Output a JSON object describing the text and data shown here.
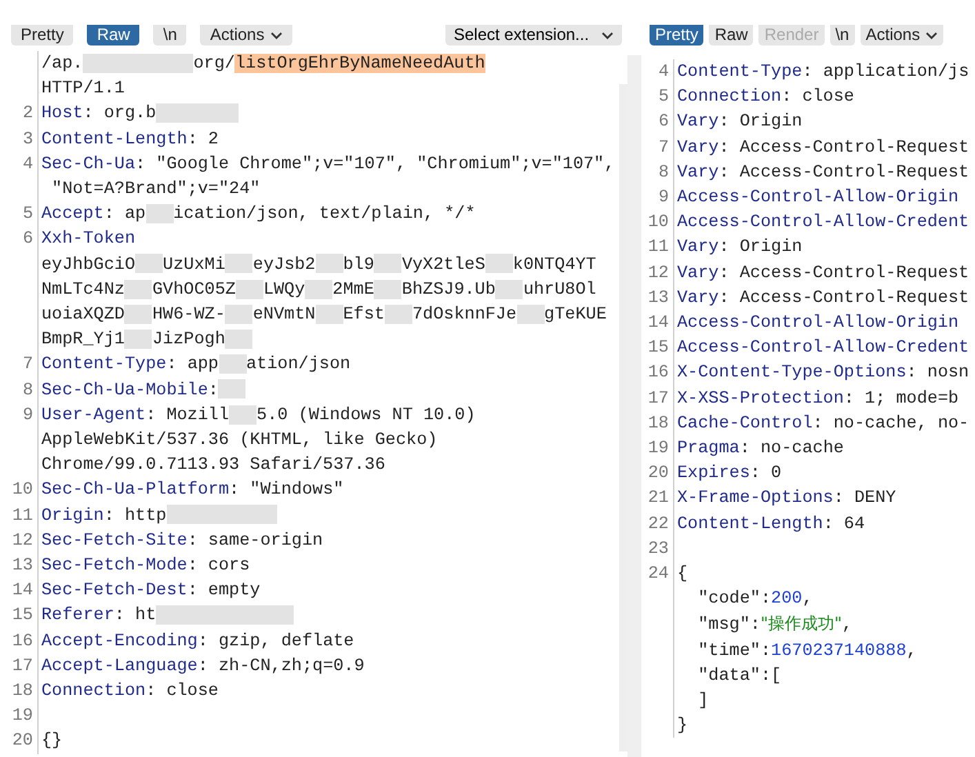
{
  "request": {
    "toolbar": [
      {
        "label": "Pretty",
        "selected": false
      },
      {
        "label": "Raw",
        "selected": true
      },
      {
        "label": "\\n",
        "selected": false
      },
      {
        "label": "Actions",
        "selected": false,
        "kind": "menu"
      }
    ],
    "extension_select": {
      "label": "Select extension..."
    },
    "lines": [
      {
        "parts": [
          {
            "kind": "text",
            "text": "/ap."
          },
          {
            "kind": "redacted"
          },
          {
            "kind": "redacted"
          },
          {
            "kind": "redacted"
          },
          {
            "kind": "redacted"
          },
          {
            "kind": "text",
            "text": "org/"
          },
          {
            "kind": "highlight",
            "text": "listOrgEhrByNameNeedAuth"
          }
        ]
      },
      {
        "parts": [
          {
            "kind": "text",
            "text": "HTTP/1.1"
          }
        ]
      },
      {
        "num": "2",
        "parts": [
          {
            "kind": "name",
            "text": "Host"
          },
          {
            "kind": "text",
            "text": ": org.b"
          },
          {
            "kind": "redacted"
          },
          {
            "kind": "redacted"
          },
          {
            "kind": "redacted"
          }
        ]
      },
      {
        "num": "3",
        "parts": [
          {
            "kind": "name",
            "text": "Content-Length"
          },
          {
            "kind": "text",
            "text": ": 2"
          }
        ]
      },
      {
        "num": "4",
        "parts": [
          {
            "kind": "name",
            "text": "Sec-Ch-Ua"
          },
          {
            "kind": "text",
            "text": ": \"Google Chrome\";v=\"107\", \"Chromium\";v=\"107\","
          }
        ]
      },
      {
        "parts": [
          {
            "kind": "text",
            "text": " \"Not=A?Brand\";v=\"24\""
          }
        ]
      },
      {
        "num": "5",
        "parts": [
          {
            "kind": "name",
            "text": "Accept"
          },
          {
            "kind": "text",
            "text": ": ap"
          },
          {
            "kind": "redacted"
          },
          {
            "kind": "text",
            "text": "ication/json, text/plain, */*"
          }
        ]
      },
      {
        "num": "6",
        "parts": [
          {
            "kind": "name",
            "text": "Xxh-Token"
          }
        ]
      },
      {
        "parts": [
          {
            "kind": "text",
            "text": "eyJhbGciO"
          },
          {
            "kind": "redacted"
          },
          {
            "kind": "text",
            "text": "UzUxMi"
          },
          {
            "kind": "redacted"
          },
          {
            "kind": "text",
            "text": "eyJsb2"
          },
          {
            "kind": "redacted"
          },
          {
            "kind": "text",
            "text": "bl9"
          },
          {
            "kind": "redacted"
          },
          {
            "kind": "text",
            "text": "VyX2tleS"
          },
          {
            "kind": "redacted"
          },
          {
            "kind": "text",
            "text": "k0NTQ4YT"
          }
        ]
      },
      {
        "parts": [
          {
            "kind": "text",
            "text": "NmLTc4Nz"
          },
          {
            "kind": "redacted"
          },
          {
            "kind": "text",
            "text": "GVhOC05Z"
          },
          {
            "kind": "redacted"
          },
          {
            "kind": "text",
            "text": "LWQy"
          },
          {
            "kind": "redacted"
          },
          {
            "kind": "text",
            "text": "2MmE"
          },
          {
            "kind": "redacted"
          },
          {
            "kind": "text",
            "text": "BhZSJ9.Ub"
          },
          {
            "kind": "redacted"
          },
          {
            "kind": "text",
            "text": "uhrU8Ol"
          }
        ]
      },
      {
        "parts": [
          {
            "kind": "text",
            "text": "uoiaXQZD"
          },
          {
            "kind": "redacted"
          },
          {
            "kind": "text",
            "text": "HW6-WZ-"
          },
          {
            "kind": "redacted"
          },
          {
            "kind": "text",
            "text": "eNVmtN"
          },
          {
            "kind": "redacted"
          },
          {
            "kind": "text",
            "text": "Efst"
          },
          {
            "kind": "redacted"
          },
          {
            "kind": "text",
            "text": "7dOsknnFJe"
          },
          {
            "kind": "redacted"
          },
          {
            "kind": "text",
            "text": "gTeKUE"
          }
        ]
      },
      {
        "parts": [
          {
            "kind": "text",
            "text": "BmpR_Yj1"
          },
          {
            "kind": "redacted"
          },
          {
            "kind": "text",
            "text": "JizPogh"
          },
          {
            "kind": "redacted"
          }
        ]
      },
      {
        "num": "7",
        "parts": [
          {
            "kind": "name",
            "text": "Content-Type"
          },
          {
            "kind": "text",
            "text": ": app"
          },
          {
            "kind": "redacted"
          },
          {
            "kind": "text",
            "text": "ation/json"
          }
        ]
      },
      {
        "num": "8",
        "parts": [
          {
            "kind": "name",
            "text": "Sec-Ch-Ua-Mobile"
          },
          {
            "kind": "text",
            "text": ":"
          },
          {
            "kind": "redacted"
          }
        ]
      },
      {
        "num": "9",
        "parts": [
          {
            "kind": "name",
            "text": "User-Agent"
          },
          {
            "kind": "text",
            "text": ": Mozill"
          },
          {
            "kind": "redacted"
          },
          {
            "kind": "text",
            "text": "5.0 (Windows NT 10.0)"
          }
        ]
      },
      {
        "parts": [
          {
            "kind": "text",
            "text": "AppleWebKit/537.36 (KHTML, like Gecko)"
          }
        ]
      },
      {
        "parts": [
          {
            "kind": "text",
            "text": "Chrome/99.0.7113.93 Safari/537.36"
          }
        ]
      },
      {
        "num": "10",
        "parts": [
          {
            "kind": "name",
            "text": "Sec-Ch-Ua-Platform"
          },
          {
            "kind": "text",
            "text": ": \"Windows\""
          }
        ]
      },
      {
        "num": "11",
        "parts": [
          {
            "kind": "name",
            "text": "Origin"
          },
          {
            "kind": "text",
            "text": ": http"
          },
          {
            "kind": "redacted"
          },
          {
            "kind": "redacted"
          },
          {
            "kind": "redacted"
          },
          {
            "kind": "redacted"
          }
        ]
      },
      {
        "num": "12",
        "parts": [
          {
            "kind": "name",
            "text": "Sec-Fetch-Site"
          },
          {
            "kind": "text",
            "text": ": same-origin"
          }
        ]
      },
      {
        "num": "13",
        "parts": [
          {
            "kind": "name",
            "text": "Sec-Fetch-Mode"
          },
          {
            "kind": "text",
            "text": ": cors"
          }
        ]
      },
      {
        "num": "14",
        "parts": [
          {
            "kind": "name",
            "text": "Sec-Fetch-Dest"
          },
          {
            "kind": "text",
            "text": ": empty"
          }
        ]
      },
      {
        "num": "15",
        "parts": [
          {
            "kind": "name",
            "text": "Referer"
          },
          {
            "kind": "text",
            "text": ": ht"
          },
          {
            "kind": "redacted"
          },
          {
            "kind": "redacted"
          },
          {
            "kind": "redacted"
          },
          {
            "kind": "redacted"
          },
          {
            "kind": "redacted"
          }
        ]
      },
      {
        "num": "16",
        "parts": [
          {
            "kind": "name",
            "text": "Accept-Encoding"
          },
          {
            "kind": "text",
            "text": ": gzip, deflate"
          }
        ]
      },
      {
        "num": "17",
        "parts": [
          {
            "kind": "name",
            "text": "Accept-Language"
          },
          {
            "kind": "text",
            "text": ": zh-CN,zh;q=0.9"
          }
        ]
      },
      {
        "num": "18",
        "parts": [
          {
            "kind": "name",
            "text": "Connection"
          },
          {
            "kind": "text",
            "text": ": close"
          }
        ]
      },
      {
        "num": "19"
      },
      {
        "num": "20",
        "parts": [
          {
            "kind": "text",
            "text": "{}"
          }
        ]
      }
    ]
  },
  "response": {
    "toolbar": [
      {
        "label": "Pretty",
        "selected": true
      },
      {
        "label": "Raw",
        "selected": false
      },
      {
        "label": "Render",
        "selected": false,
        "disabled": true
      },
      {
        "label": "\\n",
        "selected": false
      },
      {
        "label": "Actions",
        "selected": false,
        "kind": "menu"
      }
    ],
    "lines": [
      {
        "num": "4",
        "parts": [
          {
            "kind": "name",
            "text": "Content-Type"
          },
          {
            "kind": "text",
            "text": ": application/js"
          }
        ]
      },
      {
        "num": "5",
        "parts": [
          {
            "kind": "name",
            "text": "Connection"
          },
          {
            "kind": "text",
            "text": ": close"
          }
        ]
      },
      {
        "num": "6",
        "parts": [
          {
            "kind": "name",
            "text": "Vary"
          },
          {
            "kind": "text",
            "text": ": Origin"
          }
        ]
      },
      {
        "num": "7",
        "parts": [
          {
            "kind": "name",
            "text": "Vary"
          },
          {
            "kind": "text",
            "text": ": Access-Control-Request"
          }
        ]
      },
      {
        "num": "8",
        "parts": [
          {
            "kind": "name",
            "text": "Vary"
          },
          {
            "kind": "text",
            "text": ": Access-Control-Request"
          }
        ]
      },
      {
        "num": "9",
        "parts": [
          {
            "kind": "name",
            "text": "Access-Control-Allow-Origin"
          }
        ]
      },
      {
        "num": "10",
        "parts": [
          {
            "kind": "name",
            "text": "Access-Control-Allow-Credent"
          }
        ]
      },
      {
        "num": "11",
        "parts": [
          {
            "kind": "name",
            "text": "Vary"
          },
          {
            "kind": "text",
            "text": ": Origin"
          }
        ]
      },
      {
        "num": "12",
        "parts": [
          {
            "kind": "name",
            "text": "Vary"
          },
          {
            "kind": "text",
            "text": ": Access-Control-Request"
          }
        ]
      },
      {
        "num": "13",
        "parts": [
          {
            "kind": "name",
            "text": "Vary"
          },
          {
            "kind": "text",
            "text": ": Access-Control-Request"
          }
        ]
      },
      {
        "num": "14",
        "parts": [
          {
            "kind": "name",
            "text": "Access-Control-Allow-Origin"
          }
        ]
      },
      {
        "num": "15",
        "parts": [
          {
            "kind": "name",
            "text": "Access-Control-Allow-Credent"
          }
        ]
      },
      {
        "num": "16",
        "parts": [
          {
            "kind": "name",
            "text": "X-Content-Type-Options"
          },
          {
            "kind": "text",
            "text": ": nosn"
          }
        ]
      },
      {
        "num": "17",
        "parts": [
          {
            "kind": "name",
            "text": "X-XSS-Protection"
          },
          {
            "kind": "text",
            "text": ": 1; mode=b"
          }
        ]
      },
      {
        "num": "18",
        "parts": [
          {
            "kind": "name",
            "text": "Cache-Control"
          },
          {
            "kind": "text",
            "text": ": no-cache, no-"
          }
        ]
      },
      {
        "num": "19",
        "parts": [
          {
            "kind": "name",
            "text": "Pragma"
          },
          {
            "kind": "text",
            "text": ": no-cache"
          }
        ]
      },
      {
        "num": "20",
        "parts": [
          {
            "kind": "name",
            "text": "Expires"
          },
          {
            "kind": "text",
            "text": ": 0"
          }
        ]
      },
      {
        "num": "21",
        "parts": [
          {
            "kind": "name",
            "text": "X-Frame-Options"
          },
          {
            "kind": "text",
            "text": ": DENY"
          }
        ]
      },
      {
        "num": "22",
        "parts": [
          {
            "kind": "name",
            "text": "Content-Length"
          },
          {
            "kind": "text",
            "text": ": 64"
          }
        ]
      },
      {
        "num": "23"
      },
      {
        "num": "24",
        "parts": [
          {
            "kind": "text",
            "text": "{"
          }
        ]
      },
      {
        "parts": [
          {
            "kind": "text",
            "text": "  \"code\":"
          },
          {
            "kind": "number",
            "text": "200"
          },
          {
            "kind": "text",
            "text": ","
          }
        ]
      },
      {
        "parts": [
          {
            "kind": "text",
            "text": "  \"msg\":"
          },
          {
            "kind": "string",
            "text": "\"操作成功\""
          },
          {
            "kind": "text",
            "text": ","
          }
        ]
      },
      {
        "parts": [
          {
            "kind": "text",
            "text": "  \"time\":"
          },
          {
            "kind": "number",
            "text": "1670237140888"
          },
          {
            "kind": "text",
            "text": ","
          }
        ]
      },
      {
        "parts": [
          {
            "kind": "text",
            "text": "  \"data\":["
          }
        ]
      },
      {
        "parts": [
          {
            "kind": "text",
            "text": "  ]"
          }
        ]
      },
      {
        "parts": [
          {
            "kind": "text",
            "text": "}"
          }
        ]
      }
    ]
  }
}
